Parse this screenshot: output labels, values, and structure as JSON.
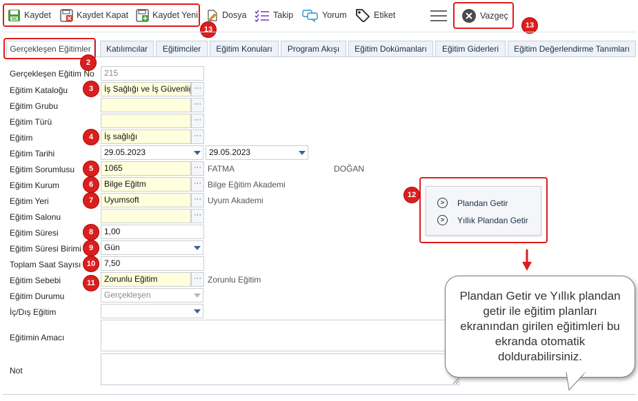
{
  "toolbar": {
    "save": "Kaydet",
    "save_close": "Kaydet Kapat",
    "save_new": "Kaydet Yeni",
    "file": "Dosya",
    "follow": "Takip",
    "comment": "Yorum",
    "tag": "Etiket",
    "cancel": "Vazgeç"
  },
  "badges": {
    "b2": "2",
    "b3": "3",
    "b4": "4",
    "b5": "5",
    "b6": "6",
    "b7": "7",
    "b8": "8",
    "b9": "9",
    "b10": "10",
    "b11": "11",
    "b12": "12",
    "b13": "13"
  },
  "tabs": [
    "Gerçekleşen Eğitimler",
    "Katılımcılar",
    "Eğitimciler",
    "Eğitim Konuları",
    "Program Akışı",
    "Eğitim Dokümanları",
    "Eğitim Giderleri",
    "Eğitim Değerlendirme Tanımları"
  ],
  "form": {
    "no_label": "Gerçekleşen Eğitim No",
    "no_value": "215",
    "katalog_label": "Eğitim Kataloğu",
    "katalog_value": "İş Sağlığı ve İş Güvenliği",
    "grup_label": "Eğitim Grubu",
    "tur_label": "Eğitim Türü",
    "egitim_label": "Eğitim",
    "egitim_value": "İş sağlığı",
    "tarih_label": "Eğitim Tarihi",
    "tarih_start": "29.05.2023",
    "tarih_end": "29.05.2023",
    "sorumlu_label": "Eğitim Sorumlusu",
    "sorumlu_value": "1065",
    "sorumlu_first": "FATMA",
    "sorumlu_last": "DOĞAN",
    "kurum_label": "Eğitim Kurum",
    "kurum_value": "Bilge Eğitm",
    "kurum_desc": "Bilge Eğitim Akademi",
    "yer_label": "Eğitim Yeri",
    "yer_value": "Uyumsoft",
    "yer_desc": "Uyum Akademi",
    "salon_label": "Eğitim Salonu",
    "sure_label": "Eğitim Süresi",
    "sure_value": "1,00",
    "birim_label": "Eğitim Süresi Birimi",
    "birim_value": "Gün",
    "saat_label": "Toplam Saat Sayısı",
    "saat_value": "7,50",
    "sebep_label": "Eğitim Sebebi",
    "sebep_value": "Zorunlu Eğitim",
    "sebep_desc": "Zorunlu Eğitim",
    "durum_label": "Eğitim Durumu",
    "durum_value": "Gerçekleşen",
    "icdis_label": "İç/Dış Eğitim",
    "amac_label": "Eğitimin Amacı",
    "not_label": "Not"
  },
  "popup": {
    "item1": "Plandan Getir",
    "item2": "Yıllık Plandan Getir"
  },
  "callout": "Plandan Getir ve Yıllık plandan getir ile eğitim planları ekranından girilen eğitimleri bu ekranda otomatik doldurabilirsiniz.",
  "colors": {
    "highlight_red": "#e01b1b",
    "required_field": "#ffffdd",
    "tab_bg": "#eef2f8"
  }
}
